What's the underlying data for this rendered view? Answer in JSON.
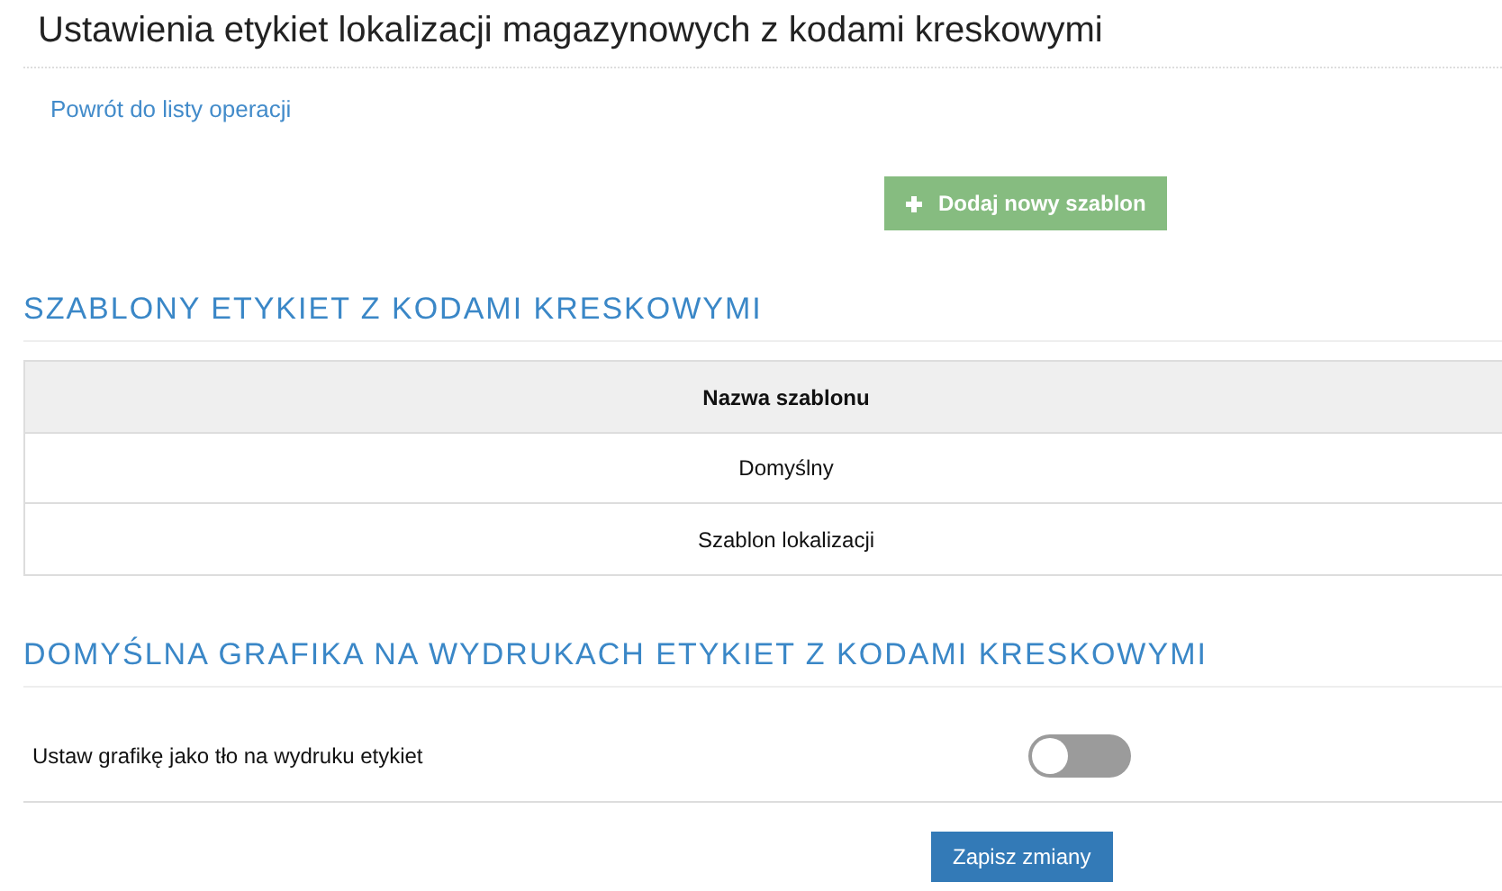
{
  "page_title": "Ustawienia etykiet lokalizacji magazynowych z kodami kreskowymi",
  "back_link": "Powrót do listy operacji",
  "add_button": "Dodaj nowy szablon",
  "templates_section": {
    "heading": "SZABLONY ETYKIET Z KODAMI KRESKOWYMI",
    "column": "Nazwa szablonu",
    "rows": [
      "Domyślny",
      "Szablon lokalizacji"
    ]
  },
  "graphics_section": {
    "heading": "DOMYŚLNA GRAFIKA NA WYDRUKACH ETYKIET Z KODAMI KRESKOWYMI",
    "setting": {
      "label": "Ustaw grafikę jako tło na wydruku etykiet",
      "on": false
    }
  },
  "save_button": "Zapisz zmiany"
}
